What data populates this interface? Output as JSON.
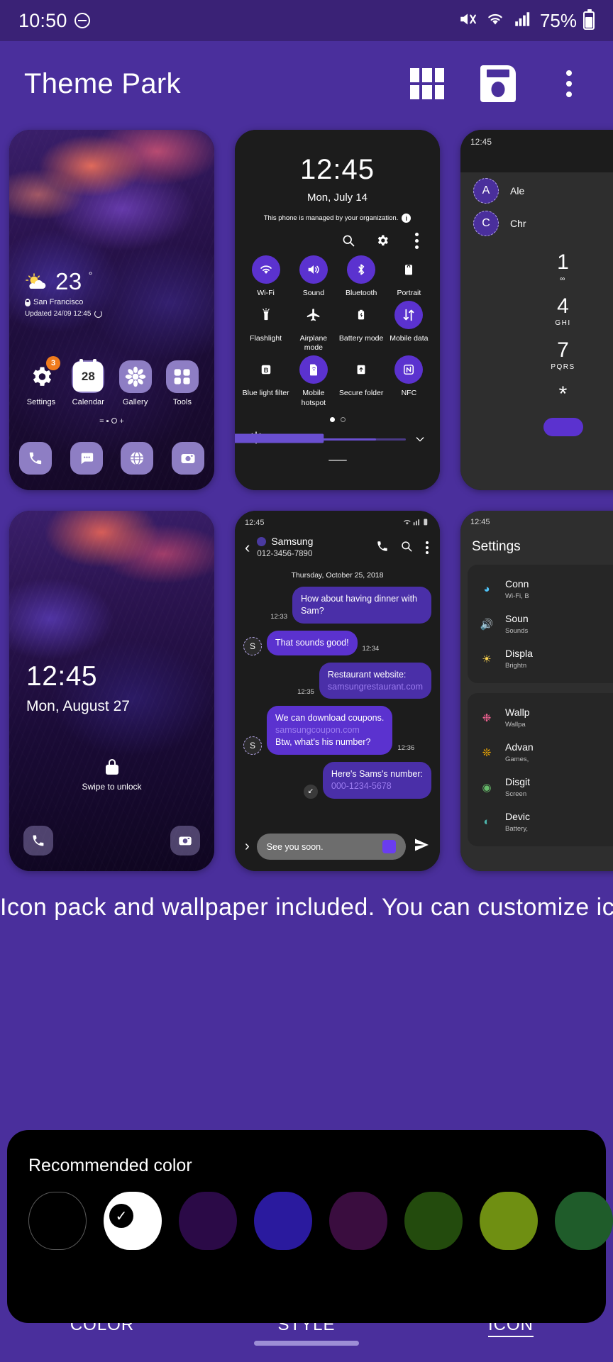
{
  "statusbar": {
    "time": "10:50",
    "dnd_icon": "do-not-disturb-icon",
    "mute_icon": "mute-icon",
    "wifi_icon": "wifi-icon",
    "signal_icon": "cellular-signal-icon",
    "battery_percent": "75%",
    "battery_icon": "battery-icon"
  },
  "appbar": {
    "title": "Theme Park",
    "grid_icon": "grid-view-icon",
    "save_icon": "save-icon",
    "overflow_icon": "more-options-icon"
  },
  "home_preview": {
    "weather": {
      "icon": "partly-cloudy-icon",
      "temp": "23",
      "degree": "°",
      "location": "San Francisco",
      "updated": "Updated 24/09 12:45",
      "refresh_icon": "refresh-icon",
      "pin_icon": "location-pin-icon"
    },
    "apps": [
      {
        "label": "Settings",
        "icon": "gear-icon",
        "badge": "3"
      },
      {
        "label": "Calendar",
        "icon": "calendar-icon",
        "day": "28"
      },
      {
        "label": "Gallery",
        "icon": "flower-icon"
      },
      {
        "label": "Tools",
        "icon": "tools-folder-icon"
      }
    ],
    "indicator": "=  ▪  ⭘ +",
    "dock": [
      {
        "icon": "phone-icon",
        "glyph": "✆"
      },
      {
        "icon": "messages-icon",
        "glyph": "…"
      },
      {
        "icon": "internet-icon",
        "glyph": "●"
      },
      {
        "icon": "camera-icon",
        "glyph": "◉"
      }
    ]
  },
  "quick_panel": {
    "time": "12:45",
    "date": "Mon, July 14",
    "notice": "This phone is managed by your organization.",
    "info_icon": "info-icon",
    "search_icon": "search-icon",
    "settings_icon": "gear-icon",
    "overflow_icon": "more-options-icon",
    "toggles": [
      {
        "label": "Wi-Fi",
        "icon": "wifi-icon",
        "state": "on"
      },
      {
        "label": "Sound",
        "icon": "sound-icon",
        "state": "on"
      },
      {
        "label": "Bluetooth",
        "icon": "bluetooth-icon",
        "state": "on"
      },
      {
        "label": "Portrait",
        "icon": "portrait-lock-icon",
        "state": "off"
      },
      {
        "label": "Flashlight",
        "icon": "flashlight-icon",
        "state": "off"
      },
      {
        "label": "Airplane mode",
        "icon": "airplane-icon",
        "state": "off"
      },
      {
        "label": "Battery mode",
        "icon": "battery-mode-icon",
        "state": "off"
      },
      {
        "label": "Mobile data",
        "icon": "mobile-data-icon",
        "state": "on"
      },
      {
        "label": "Blue light filter",
        "icon": "blue-light-filter-icon",
        "state": "off"
      },
      {
        "label": "Mobile hotspot",
        "icon": "hotspot-icon",
        "state": "on"
      },
      {
        "label": "Secure folder",
        "icon": "secure-folder-icon",
        "state": "off"
      },
      {
        "label": "NFC",
        "icon": "nfc-icon",
        "state": "on"
      }
    ],
    "brightness_icon": "brightness-icon",
    "expand_icon": "chevron-down-icon"
  },
  "dialer_preview": {
    "status_time": "12:45",
    "contacts": [
      {
        "initial": "A",
        "name": "Ale"
      },
      {
        "initial": "C",
        "name": "Chr"
      }
    ],
    "keys": [
      {
        "number": "1",
        "sub": "∞"
      },
      {
        "number": "4",
        "sub": "GHI"
      },
      {
        "number": "7",
        "sub": "PQRS"
      },
      {
        "number": "*",
        "sub": ""
      }
    ],
    "call_button_icon": "call-button"
  },
  "lock_preview": {
    "time": "12:45",
    "date": "Mon, August 27",
    "hint": "Swipe to unlock",
    "lock_icon": "lock-icon",
    "dock": [
      {
        "icon": "phone-icon",
        "glyph": "✆"
      },
      {
        "icon": "camera-icon",
        "glyph": "◉"
      }
    ]
  },
  "messages_preview": {
    "status_time": "12:45",
    "wifi_icon": "wifi-icon",
    "signal_icon": "cellular-signal-icon",
    "battery_icon": "battery-icon",
    "back_icon": "back-arrow-icon",
    "contact_name": "Samsung",
    "contact_number": "012-3456-7890",
    "call_icon": "phone-icon",
    "search_icon": "search-icon",
    "overflow_icon": "more-options-icon",
    "day_divider": "Thursday, October 25, 2018",
    "messages": [
      {
        "dir": "out",
        "text": "How about having dinner with Sam?",
        "time": "12:33",
        "avatar": ""
      },
      {
        "dir": "in",
        "text": "That sounds good!",
        "time": "12:34",
        "avatar": "S"
      },
      {
        "dir": "out",
        "text": "Restaurant website:",
        "link": "samsungrestaurant.com",
        "time": "12:35",
        "avatar": ""
      },
      {
        "dir": "in",
        "text": "We can download coupons.",
        "link": "samsungcoupon.com",
        "text2": "Btw, what's his number?",
        "time": "12:36",
        "avatar": "S"
      },
      {
        "dir": "out",
        "text": "Here's Sams's number:",
        "link": "000-1234-5678",
        "time": "",
        "avatar": "↙"
      }
    ],
    "input_value": "See you soon.",
    "plus_icon": "expand-arrow-icon",
    "emoji_icon": "sticker-icon",
    "send_icon": "send-icon"
  },
  "settings_preview": {
    "status_time": "12:45",
    "title": "Settings",
    "groups": [
      [
        {
          "title": "Conn",
          "sub": "Wi-Fi, B",
          "icon": "wifi-icon",
          "color": "#4fc3f7"
        },
        {
          "title": "Soun",
          "sub": "Sounds",
          "icon": "sound-icon",
          "color": "#b39ddb"
        },
        {
          "title": "Displa",
          "sub": "Brightn",
          "icon": "brightness-icon",
          "color": "#ffd54f"
        }
      ],
      [
        {
          "title": "Wallp",
          "sub": "Wallpa",
          "icon": "wallpaper-icon",
          "color": "#f06292"
        },
        {
          "title": "Advan",
          "sub": "Games,",
          "icon": "advanced-icon",
          "color": "#ffb300"
        },
        {
          "title": "Disgit",
          "sub": "Screen",
          "icon": "digital-wellbeing-icon",
          "color": "#66bb6a"
        },
        {
          "title": "Devic",
          "sub": "Battery,",
          "icon": "device-care-icon",
          "color": "#4db6ac"
        }
      ]
    ]
  },
  "bleed_text": "Icon pack and wallpaper included. You can customize icons from the",
  "bottom_sheet": {
    "title": "Recommended color",
    "swatches": [
      {
        "name": "custom",
        "color": "#000000",
        "outline": true,
        "selected": false
      },
      {
        "name": "white",
        "color": "#ffffff",
        "outline": false,
        "selected": true
      },
      {
        "name": "deep-purple",
        "color": "#2b0a47",
        "outline": false,
        "selected": false
      },
      {
        "name": "indigo",
        "color": "#2a1a9e",
        "outline": false,
        "selected": false
      },
      {
        "name": "plum",
        "color": "#3a0d3f",
        "outline": false,
        "selected": false
      },
      {
        "name": "dark-green",
        "color": "#234b0d",
        "outline": false,
        "selected": false
      },
      {
        "name": "olive",
        "color": "#6f8f12",
        "outline": false,
        "selected": false
      },
      {
        "name": "forest",
        "color": "#1f5c2a",
        "outline": false,
        "selected": false
      }
    ],
    "check_icon": "check-icon"
  },
  "tabs": [
    {
      "label": "COLOR",
      "selected": false
    },
    {
      "label": "STYLE",
      "selected": false
    },
    {
      "label": "ICON",
      "selected": true
    }
  ],
  "navbar": {
    "home_pill": "home-indicator"
  },
  "colors": {
    "brand_purple": "#4a2f9c",
    "status_purple": "#3a2276",
    "accent": "#5b32cf",
    "sheet_bg": "#000000",
    "badge_orange": "#f07b1d"
  }
}
